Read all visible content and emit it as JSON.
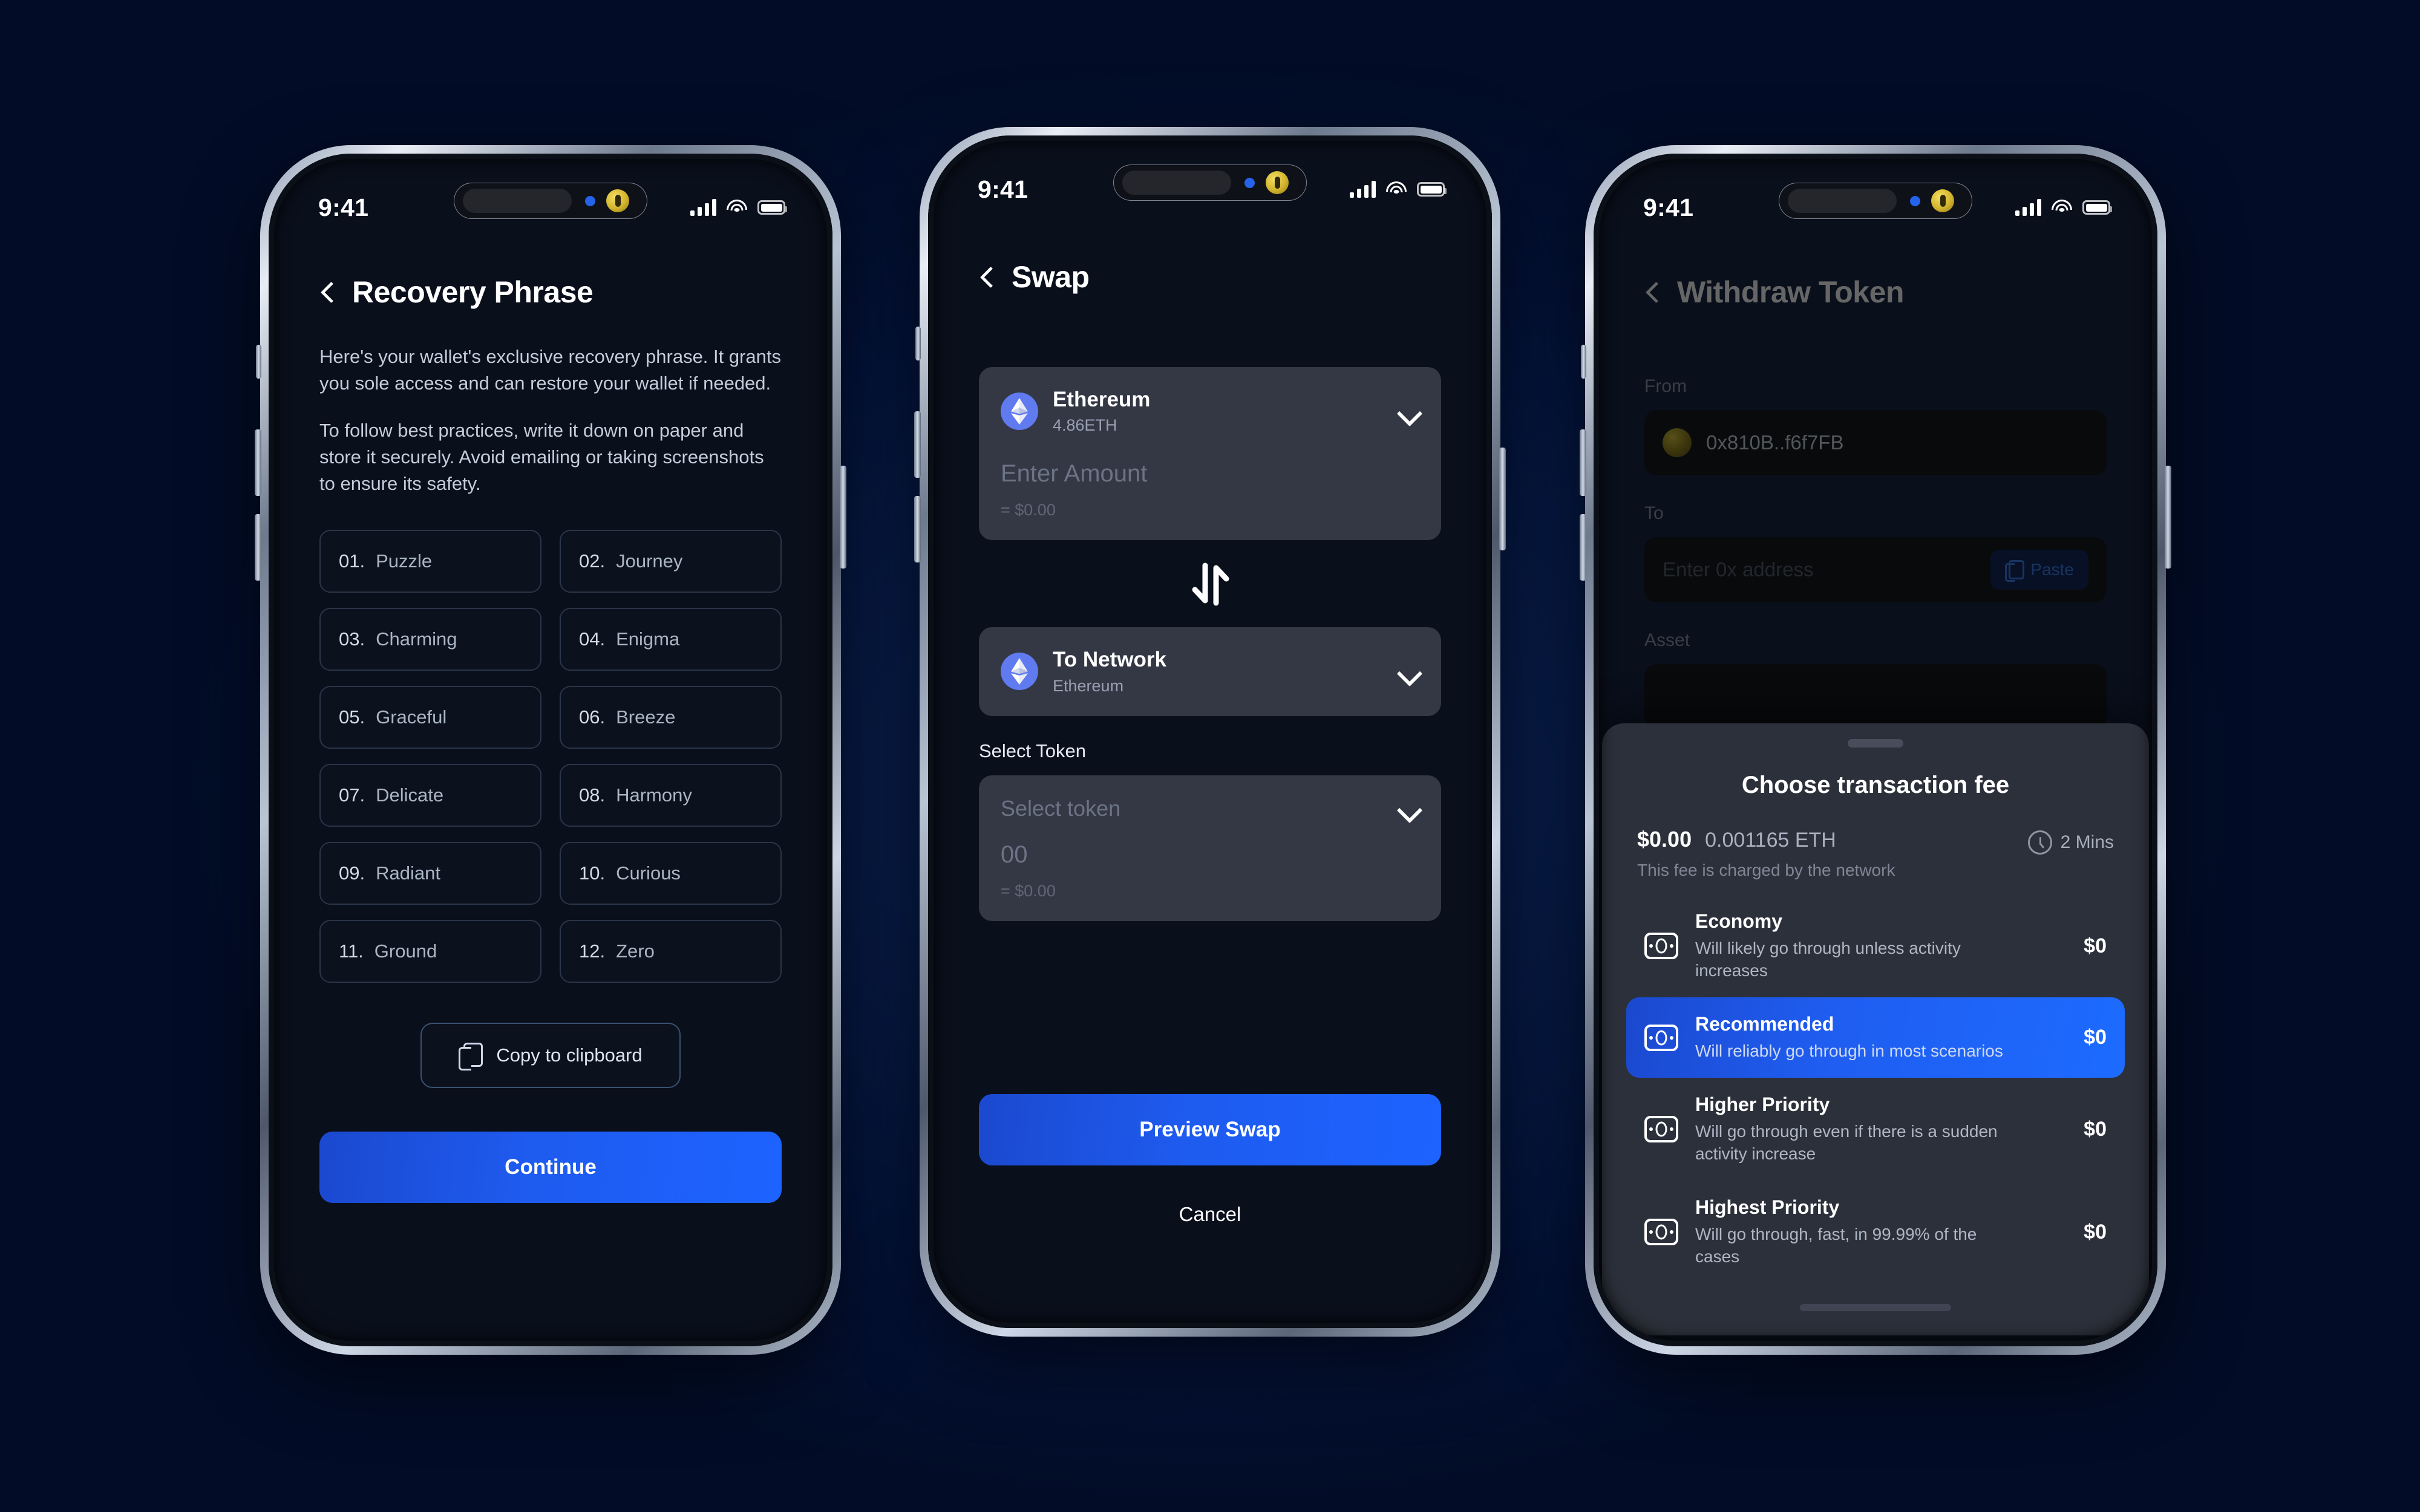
{
  "background": {
    "color": "#04133a"
  },
  "accent": {
    "blue": "#1d63ff",
    "eth_icon_bg": "#607af0"
  },
  "status_bar": {
    "time": "9:41",
    "signal_icon": "cellular-bars-icon",
    "wifi_icon": "wifi-icon",
    "battery_icon": "battery-icon"
  },
  "phone1": {
    "nav": {
      "back_icon": "chevron-left-icon",
      "title": "Recovery Phrase"
    },
    "description": [
      "Here's your wallet's exclusive recovery phrase. It grants you sole access and can restore your wallet if needed.",
      "To follow best practices, write it down on paper and store it securely. Avoid emailing or taking screenshots to ensure its safety."
    ],
    "words": [
      {
        "num": "01.",
        "word": "Puzzle"
      },
      {
        "num": "02.",
        "word": "Journey"
      },
      {
        "num": "03.",
        "word": "Charming"
      },
      {
        "num": "04.",
        "word": "Enigma"
      },
      {
        "num": "05.",
        "word": "Graceful"
      },
      {
        "num": "06.",
        "word": "Breeze"
      },
      {
        "num": "07.",
        "word": "Delicate"
      },
      {
        "num": "08.",
        "word": "Harmony"
      },
      {
        "num": "09.",
        "word": "Radiant"
      },
      {
        "num": "10.",
        "word": "Curious"
      },
      {
        "num": "11.",
        "word": "Ground"
      },
      {
        "num": "12.",
        "word": "Zero"
      }
    ],
    "copy_button": {
      "label": "Copy to clipboard",
      "icon": "copy-icon"
    },
    "primary_button": {
      "label": "Continue"
    }
  },
  "phone2": {
    "nav": {
      "back_icon": "chevron-left-icon",
      "title": "Swap"
    },
    "from_card": {
      "token_icon": "ethereum-icon",
      "title": "Ethereum",
      "balance": "4.86ETH",
      "amount_placeholder": "Enter Amount",
      "usd_value": "= $0.00",
      "chevron_icon": "chevron-down-icon"
    },
    "swap_icon": "swap-arrows-icon",
    "to_card": {
      "token_icon": "ethereum-icon",
      "title": "To Network",
      "network": "Ethereum",
      "chevron_icon": "chevron-down-icon"
    },
    "select_token_label": "Select Token",
    "token_card": {
      "placeholder": "Select token",
      "amount": "00",
      "usd_value": "= $0.00",
      "chevron_icon": "chevron-down-icon"
    },
    "primary_button": {
      "label": "Preview Swap"
    },
    "cancel_button": {
      "label": "Cancel"
    }
  },
  "phone3": {
    "nav": {
      "back_icon": "chevron-left-icon",
      "title": "Withdraw Token"
    },
    "from": {
      "label": "From",
      "avatar_icon": "wallet-avatar-icon",
      "value": "0x810B..f6f7FB"
    },
    "to": {
      "label": "To",
      "placeholder": "Enter 0x address",
      "paste_label": "Paste",
      "paste_icon": "paste-icon"
    },
    "asset": {
      "label": "Asset"
    },
    "sheet": {
      "grabber_icon": "drag-handle-icon",
      "title": "Choose transaction fee",
      "fee_usd": "$0.00",
      "fee_eth": "0.001165 ETH",
      "fee_note": "This fee is charged by the network",
      "time_icon": "clock-icon",
      "time": "2 Mins",
      "options": [
        {
          "icon": "cash-icon",
          "name": "Economy",
          "desc": "Will likely go through unless activity increases",
          "price": "$0",
          "selected": false
        },
        {
          "icon": "cash-icon",
          "name": "Recommended",
          "desc": "Will reliably go through in most scenarios",
          "price": "$0",
          "selected": true
        },
        {
          "icon": "cash-icon",
          "name": "Higher Priority",
          "desc": "Will go through even if there is a sudden activity increase",
          "price": "$0",
          "selected": false
        },
        {
          "icon": "cash-icon",
          "name": "Highest Priority",
          "desc": "Will  go through, fast, in 99.99% of the cases",
          "price": "$0",
          "selected": false
        }
      ],
      "home_indicator": "home-indicator"
    }
  }
}
